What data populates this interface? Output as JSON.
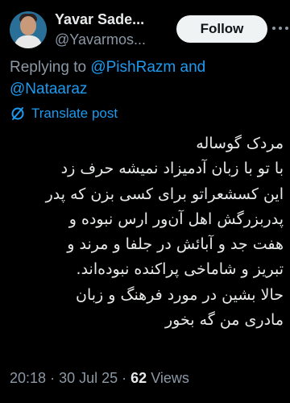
{
  "author": {
    "display_name": "Yavar Sade...",
    "handle": "@Yavarmos..."
  },
  "follow_label": "Follow",
  "reply": {
    "prefix": "Replying to",
    "mention_1": "@PishRazm",
    "joiner": "and",
    "mention_2": "@Nataaraz"
  },
  "translate_label": "Translate post",
  "tweet": {
    "lines": [
      "مردک گوساله",
      "با تو با زبان آدمیزاد نمیشه حرف زد",
      "این کسشعراتو برای کسی بزن که پدر",
      "پدربزرگش اهل آن‌ور ارس نبوده و",
      "هفت جد و آبائش در جلفا و مرند و",
      "تبریز و شاماخی پراکنده نبوده‌اند.",
      "حالا بشین در مورد فرهنگ و زبان",
      "مادری من گه بخور"
    ]
  },
  "meta": {
    "time": "20:18",
    "sep1": "·",
    "date": "30 Jul 25",
    "sep2": "·",
    "views_count": "62",
    "views_label": "Views"
  },
  "colors": {
    "background": "#000000",
    "accent": "#1d9bf0",
    "secondary_text": "#8b98a5",
    "primary_text": "#e7e9ea"
  }
}
